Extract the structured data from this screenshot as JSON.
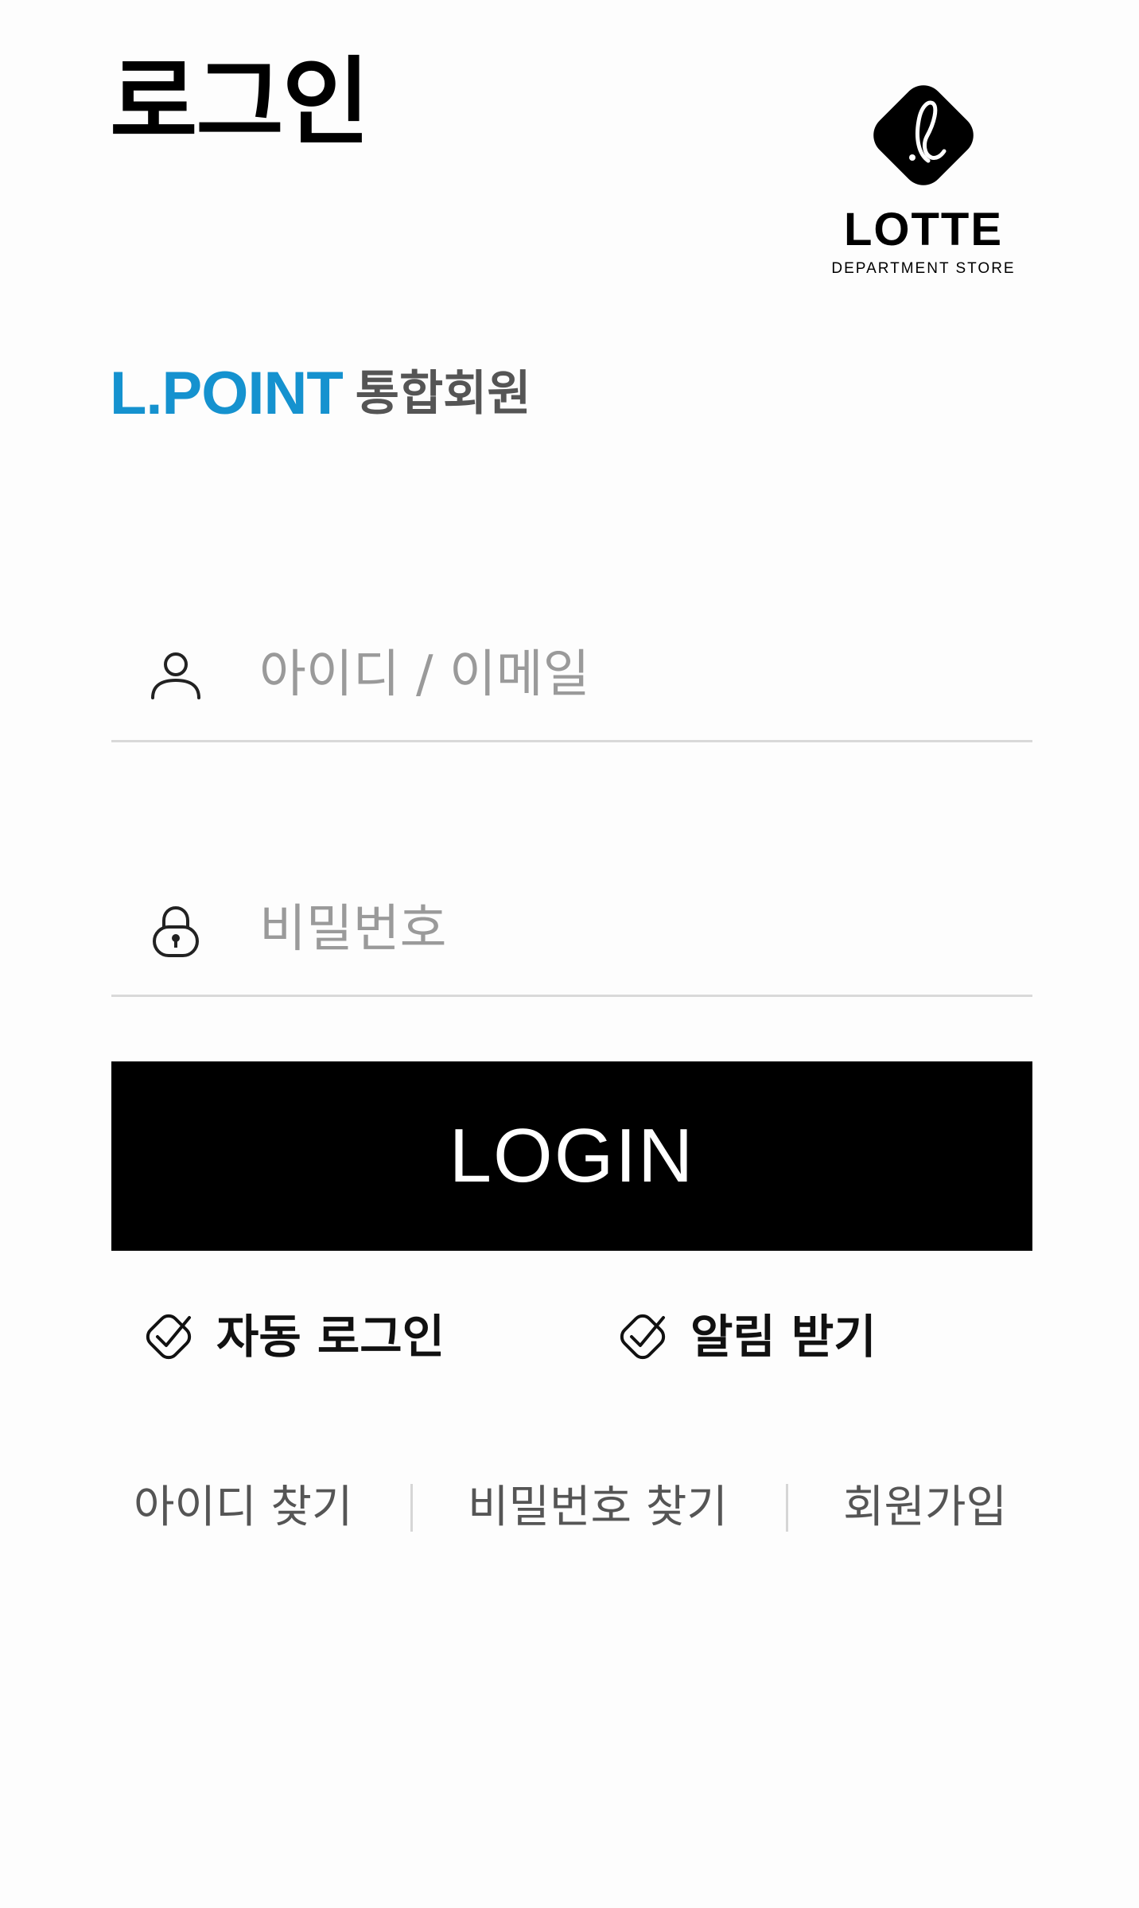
{
  "header": {
    "title": "로그인"
  },
  "logo": {
    "wordmark": "LOTTE",
    "subtitle": "DEPARTMENT STORE",
    "icon": "lotte-l-mark-icon"
  },
  "membership": {
    "brand": "L.POINT",
    "suffix": "통합회원",
    "brand_color": "#1592cf"
  },
  "form": {
    "id_placeholder": "아이디 / 이메일",
    "id_value": "",
    "id_icon": "user-icon",
    "password_placeholder": "비밀번호",
    "password_value": "",
    "password_icon": "lock-icon",
    "login_label": "LOGIN"
  },
  "options": {
    "auto_login": {
      "label": "자동 로그인",
      "icon": "check-icon"
    },
    "notifications": {
      "label": "알림 받기",
      "icon": "check-icon"
    }
  },
  "links": {
    "find_id": "아이디 찾기",
    "find_password": "비밀번호 찾기",
    "join": "회원가입"
  },
  "colors": {
    "button_background": "#000000",
    "button_text": "#ffffff",
    "divider": "#d9d9d9",
    "placeholder": "#9a9a9a"
  }
}
